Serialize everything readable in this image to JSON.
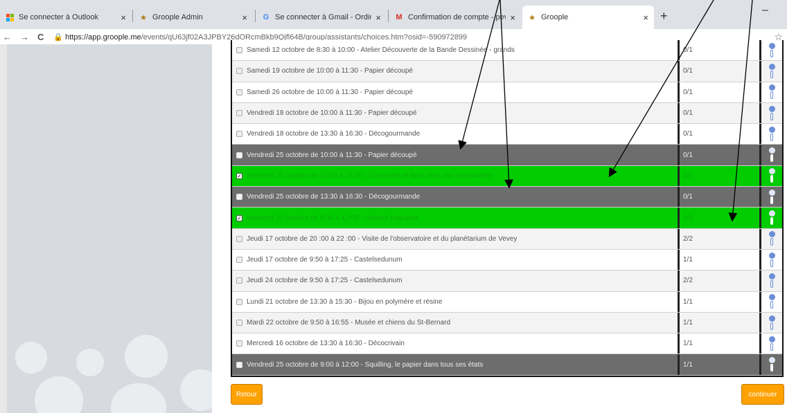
{
  "tabs": [
    {
      "title": "Se connecter à Outlook",
      "close": "×",
      "icon": "microsoft-icon"
    },
    {
      "title": "Groople Admin",
      "close": "×",
      "icon": "groople-icon"
    },
    {
      "title": "Se connecter à Gmail - Ordinateu",
      "close": "×",
      "icon": "google-icon"
    },
    {
      "title": "Confirmation de compte - peven",
      "close": "×",
      "icon": "gmail-icon"
    },
    {
      "title": "Groople",
      "close": "×",
      "icon": "groople-icon"
    }
  ],
  "new_tab": "+",
  "minimize": "–",
  "nav": {
    "back": "←",
    "forward": "→",
    "reload": "C"
  },
  "address": {
    "host": "https://app.groople.me",
    "path": "/events/qU63jf02A3JPBY26dORcmBkb9Qjfl64B/group/assistants/choices.htm?osid=-590972899"
  },
  "bookmark": "☆",
  "rows": [
    {
      "label": "Samedi 12 octobre de 8:30 à 10:00 - Atelier Découverte de la Bande Dessinée - grands",
      "count": "0/1",
      "style": "w",
      "checked": false
    },
    {
      "label": "Samedi 19 octobre de 10:00 à 11:30 - Papier découpé",
      "count": "0/1",
      "style": "g",
      "checked": false
    },
    {
      "label": "Samedi 26 octobre de 10:00 à 11:30 - Papier découpé",
      "count": "0/1",
      "style": "w",
      "checked": false
    },
    {
      "label": "Vendredi 18 octobre de 10:00 à 11:30 - Papier découpé",
      "count": "0/1",
      "style": "g",
      "checked": false
    },
    {
      "label": "Vendredi 18 octobre de 13:30 à 16:30 - Décogourmande",
      "count": "0/1",
      "style": "w",
      "checked": false
    },
    {
      "label": "Vendredi 25 octobre de 10:00 à 11:30 - Papier découpé",
      "count": "0/1",
      "style": "d",
      "checked": false
    },
    {
      "label": "Vendredi 25 octobre de 13:00 à 15:00 - Construire et faire vivre une marionnette",
      "count": "1/2",
      "style": "s",
      "checked": true
    },
    {
      "label": "Vendredi 25 octobre de 13:30 à 16:30 - Décogourmande",
      "count": "0/1",
      "style": "d",
      "checked": false
    },
    {
      "label": "Vendredi 25 octobre de 8:30 à 12:00 - Histoire fraguena",
      "count": "1/2",
      "style": "s",
      "checked": true
    },
    {
      "label": "Jeudi 17 octobre de 20 :00 à 22 :00 - Visite de l'observatoire et du planétarium de Vevey",
      "count": "2/2",
      "style": "g",
      "checked": false
    },
    {
      "label": "Jeudi 17 octobre de 9:50 à 17:25 - Castelsedunum",
      "count": "1/1",
      "style": "w",
      "checked": false
    },
    {
      "label": "Jeudi 24 octobre de 9:50 à 17:25 - Castelsedunum",
      "count": "2/2",
      "style": "g",
      "checked": false
    },
    {
      "label": "Lundi 21 octobre de 13:30 à 15:30 - Bijou en polymère et résine",
      "count": "1/1",
      "style": "w",
      "checked": false
    },
    {
      "label": "Mardi 22 octobre de 9:50 à 16:55 - Musée et chiens du St-Bernard",
      "count": "1/1",
      "style": "g",
      "checked": false
    },
    {
      "label": "Mercredi 16 octobre de 13:30 à 16:30 - Décocrivain",
      "count": "1/1",
      "style": "w",
      "checked": false
    },
    {
      "label": "Vendredi 25 octobre de 9:00 à 12:00 - Squilling, le papier dans tous ses états",
      "count": "1/1",
      "style": "d",
      "checked": false
    }
  ],
  "buttons": {
    "back": "Retour",
    "continue": "continuer"
  },
  "colors": {
    "selected_row": "#00cc00",
    "disabled_row": "#6d6d6d",
    "button": "#ffa100"
  }
}
